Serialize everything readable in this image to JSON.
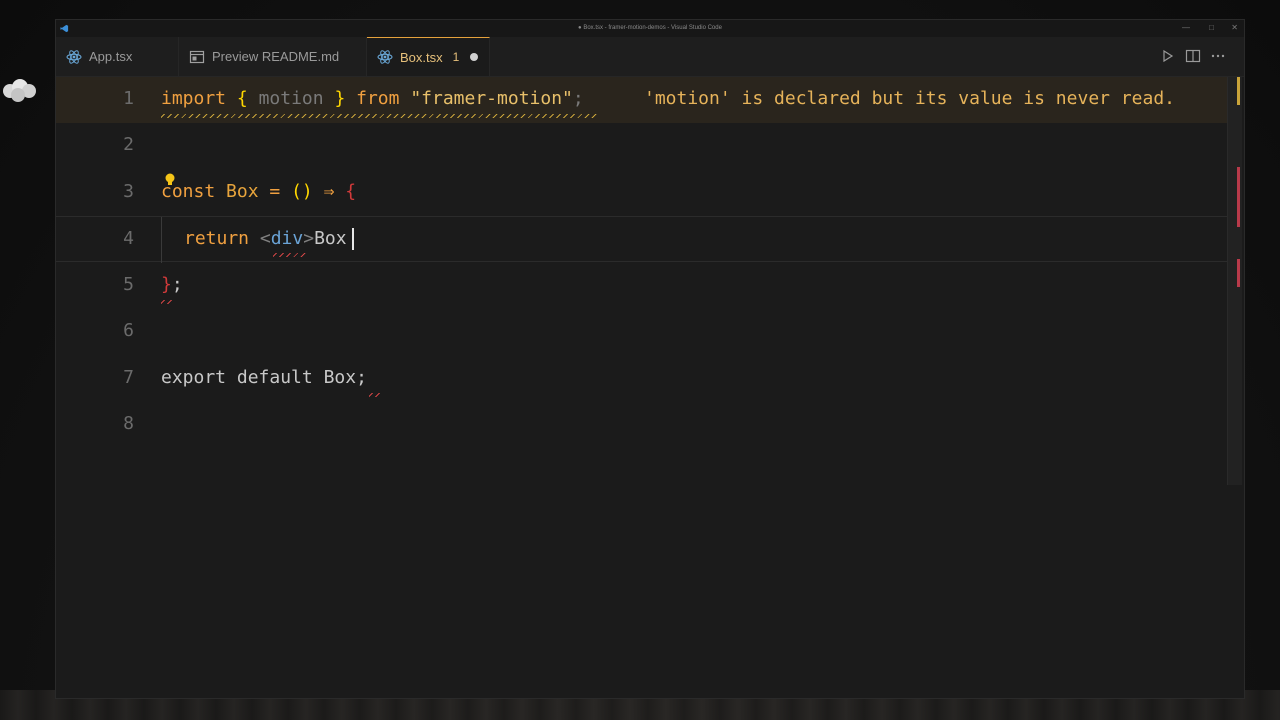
{
  "window": {
    "title": "● Box.tsx - framer-motion-demos - Visual Studio Code",
    "controls": [
      "—",
      "□",
      "✕"
    ]
  },
  "tabs": [
    {
      "label": "App.tsx",
      "icon": "react-icon",
      "active": false
    },
    {
      "label": "Preview README.md",
      "icon": "preview-icon",
      "active": false
    },
    {
      "label": "Box.tsx",
      "icon": "react-icon",
      "active": true,
      "problems": "1",
      "modified": true
    }
  ],
  "editor_actions": [
    "run-icon",
    "split-editor-icon",
    "more-icon"
  ],
  "code": {
    "line_numbers": [
      "1",
      "2",
      "3",
      "4",
      "5",
      "6",
      "7",
      "8"
    ],
    "l1": {
      "import": "import",
      "open": "{",
      "motion": "motion",
      "close": "}",
      "from": "from",
      "module": "\"framer-motion\"",
      "semi": ";"
    },
    "diagnostic": "'motion' is declared but its value is never read.",
    "l3": {
      "const": "const",
      "name": "Box",
      "eq": "=",
      "parens": "()",
      "arrow": "⇒",
      "brace": "{"
    },
    "l4": {
      "return": "return",
      "lt": "<",
      "tag": "div",
      "gt": ">",
      "text": "Box"
    },
    "l5": {
      "brace": "}",
      "semi": ";"
    },
    "l7": {
      "export": "export",
      "default": "default",
      "name": "Box",
      "semi": ";"
    }
  },
  "colors": {
    "accent": "#e6a23c",
    "keyword": "#f0a040",
    "bracket": "#ffd700",
    "error": "#d04545",
    "warning": "#c9a43a"
  }
}
